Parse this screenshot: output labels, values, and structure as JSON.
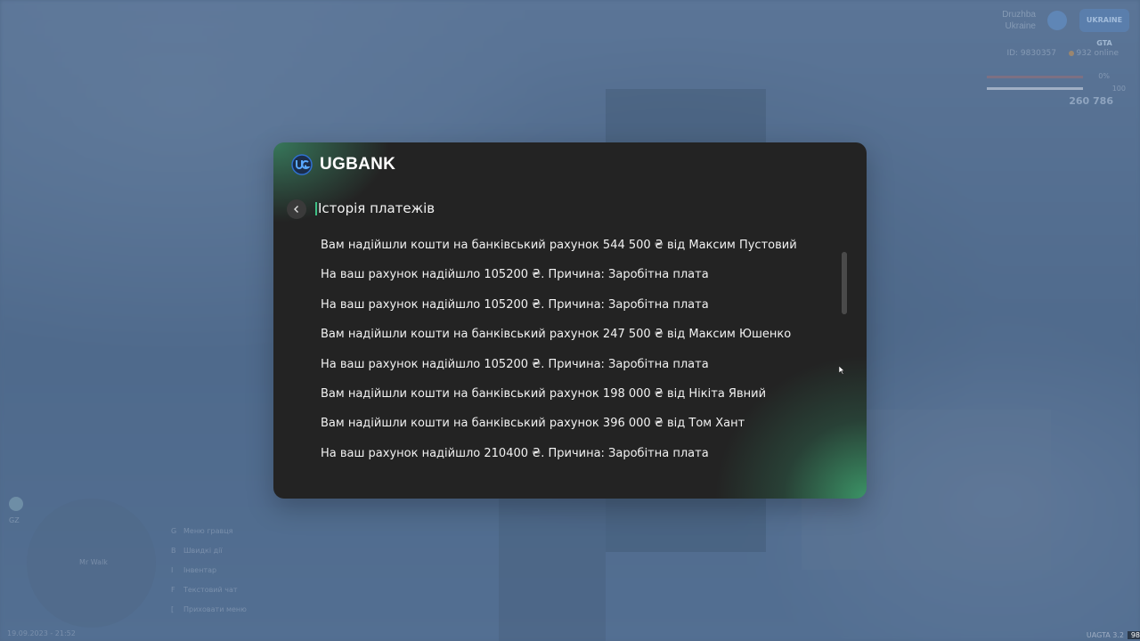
{
  "hud": {
    "server_line1": "Druzhba",
    "server_line2": "Ukraine",
    "logo_text": "UKRAINE GTA",
    "player_id": "ID: 9830357",
    "online": "932 online",
    "bar1_value": "0%",
    "bar2_value": "100",
    "money": "260 786",
    "minimap_label": "Mr Walk",
    "map_badge": "GZ",
    "hints": [
      {
        "key": "G",
        "label": "Меню гравця"
      },
      {
        "key": "B",
        "label": "Швидкі дії"
      },
      {
        "key": "I",
        "label": "Інвентар"
      },
      {
        "key": "F",
        "label": "Текстовий чат"
      },
      {
        "key": "[",
        "label": "Приховати меню"
      }
    ],
    "datetime": "19.09.2023 - 21:52",
    "version": "UAGTA 3.2",
    "fps": "98"
  },
  "bank": {
    "brand_name": "UGBANK",
    "page_title": "Історія платежів",
    "transactions": [
      "Вам надійшли кошти на банківський рахунок 544 500 ₴ від Максим Пустовий",
      "На ваш рахунок надійшло 105200 ₴. Причина: Заробітна плата",
      "На ваш рахунок надійшло 105200 ₴. Причина: Заробітна плата",
      "Вам надійшли кошти на банківський рахунок 247 500 ₴ від Максим Юшенко",
      "На ваш рахунок надійшло 105200 ₴. Причина: Заробітна плата",
      "Вам надійшли кошти на банківський рахунок 198 000 ₴ від Нікіта Явний",
      "Вам надійшли кошти на банківський рахунок 396 000 ₴ від Том Хант",
      "На ваш рахунок надійшло 210400 ₴. Причина: Заробітна плата"
    ],
    "colors": {
      "accent": "#3fbf85",
      "panel": "#232323",
      "gradient": "#3ea06e"
    }
  }
}
